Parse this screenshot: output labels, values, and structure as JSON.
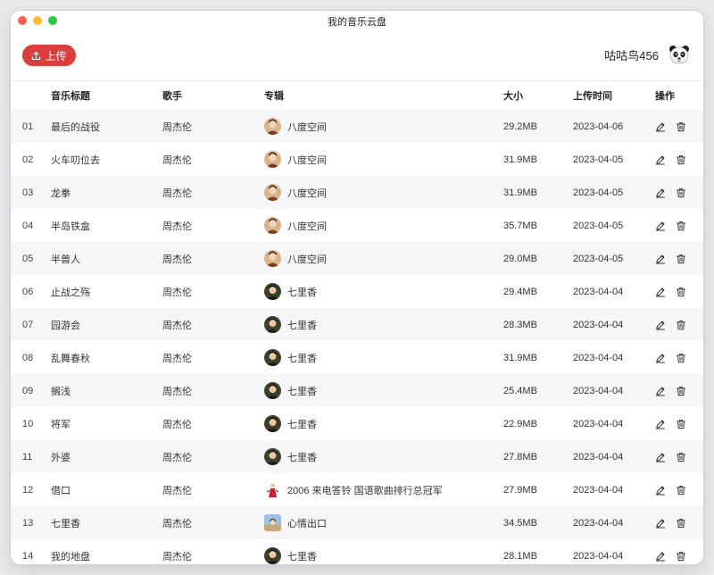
{
  "window": {
    "title": "我的音乐云盘"
  },
  "toolbar": {
    "upload_label": "上传"
  },
  "user": {
    "name": "咕咕鸟456"
  },
  "table": {
    "headers": {
      "title": "音乐标题",
      "singer": "歌手",
      "album": "专辑",
      "size": "大小",
      "date": "上传时间",
      "ops": "操作"
    },
    "rows": [
      {
        "num": "01",
        "title": "最后的战役",
        "singer": "周杰伦",
        "album": "八度空间",
        "cover": "portrait-brown",
        "size": "29.2MB",
        "date": "2023-04-06"
      },
      {
        "num": "02",
        "title": "火车叨位去",
        "singer": "周杰伦",
        "album": "八度空间",
        "cover": "portrait-brown",
        "size": "31.9MB",
        "date": "2023-04-05"
      },
      {
        "num": "03",
        "title": "龙拳",
        "singer": "周杰伦",
        "album": "八度空间",
        "cover": "portrait-brown",
        "size": "31.9MB",
        "date": "2023-04-05"
      },
      {
        "num": "04",
        "title": "半岛铁盒",
        "singer": "周杰伦",
        "album": "八度空间",
        "cover": "portrait-brown",
        "size": "35.7MB",
        "date": "2023-04-05"
      },
      {
        "num": "05",
        "title": "半兽人",
        "singer": "周杰伦",
        "album": "八度空间",
        "cover": "portrait-brown",
        "size": "29.0MB",
        "date": "2023-04-05"
      },
      {
        "num": "06",
        "title": "止战之殇",
        "singer": "周杰伦",
        "album": "七里香",
        "cover": "portrait-dark",
        "size": "29.4MB",
        "date": "2023-04-04"
      },
      {
        "num": "07",
        "title": "园游会",
        "singer": "周杰伦",
        "album": "七里香",
        "cover": "portrait-dark",
        "size": "28.3MB",
        "date": "2023-04-04"
      },
      {
        "num": "08",
        "title": "乱舞春秋",
        "singer": "周杰伦",
        "album": "七里香",
        "cover": "portrait-dark",
        "size": "31.9MB",
        "date": "2023-04-04"
      },
      {
        "num": "09",
        "title": "搁浅",
        "singer": "周杰伦",
        "album": "七里香",
        "cover": "portrait-dark",
        "size": "25.4MB",
        "date": "2023-04-04"
      },
      {
        "num": "10",
        "title": "将军",
        "singer": "周杰伦",
        "album": "七里香",
        "cover": "portrait-dark",
        "size": "22.9MB",
        "date": "2023-04-04"
      },
      {
        "num": "11",
        "title": "外婆",
        "singer": "周杰伦",
        "album": "七里香",
        "cover": "portrait-dark",
        "size": "27.8MB",
        "date": "2023-04-04"
      },
      {
        "num": "12",
        "title": "借口",
        "singer": "周杰伦",
        "album": "2006 来电答铃 国语歌曲排行总冠军",
        "cover": "figure-red",
        "size": "27.9MB",
        "date": "2023-04-04"
      },
      {
        "num": "13",
        "title": "七里香",
        "singer": "周杰伦",
        "album": "心情出口",
        "cover": "landscape-blue",
        "size": "34.5MB",
        "date": "2023-04-04"
      },
      {
        "num": "14",
        "title": "我的地盘",
        "singer": "周杰伦",
        "album": "七里香",
        "cover": "portrait-dark",
        "size": "28.1MB",
        "date": "2023-04-04"
      }
    ]
  },
  "icons": {
    "upload": "upload-icon",
    "edit": "edit-icon",
    "delete": "trash-icon",
    "avatar": "panda-avatar"
  },
  "colors": {
    "accent": "#dc3d3d",
    "row_stripe": "#f6f6f8"
  }
}
